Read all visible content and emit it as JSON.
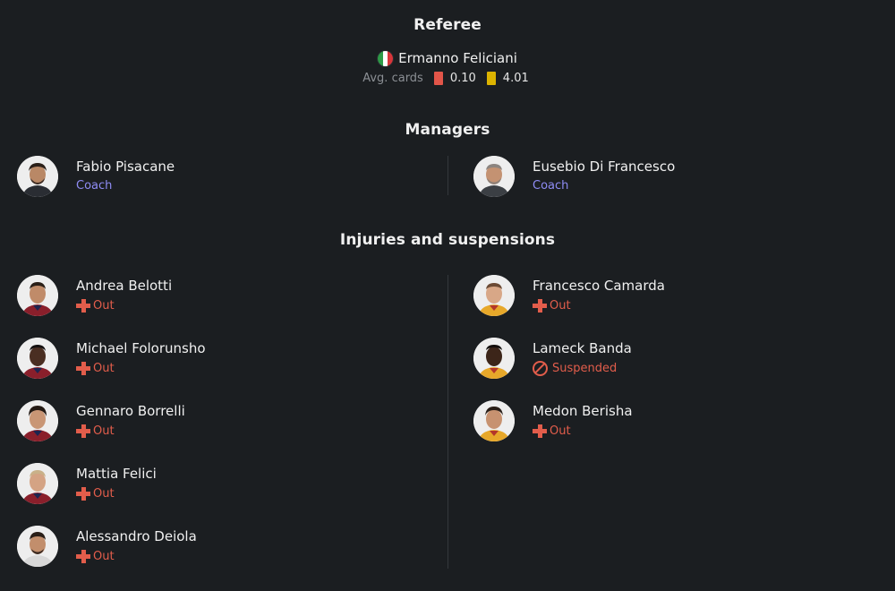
{
  "referee": {
    "title": "Referee",
    "name": "Ermanno Feliciani",
    "flag_icon": "italy-flag-icon",
    "avg_cards_label": "Avg. cards",
    "red_avg": "0.10",
    "yellow_avg": "4.01",
    "colors": {
      "red_card": "#e25549",
      "yellow_card": "#dcb300"
    }
  },
  "managers": {
    "title": "Managers",
    "home": {
      "name": "Fabio Pisacane",
      "role": "Coach"
    },
    "away": {
      "name": "Eusebio Di Francesco",
      "role": "Coach"
    }
  },
  "injuries": {
    "title": "Injuries and suspensions",
    "home": [
      {
        "name": "Andrea Belotti",
        "status": "Out",
        "icon": "injury-cross-icon"
      },
      {
        "name": "Michael Folorunsho",
        "status": "Out",
        "icon": "injury-cross-icon"
      },
      {
        "name": "Gennaro Borrelli",
        "status": "Out",
        "icon": "injury-cross-icon"
      },
      {
        "name": "Mattia Felici",
        "status": "Out",
        "icon": "injury-cross-icon"
      },
      {
        "name": "Alessandro Deiola",
        "status": "Out",
        "icon": "injury-cross-icon"
      }
    ],
    "away": [
      {
        "name": "Francesco Camarda",
        "status": "Out",
        "icon": "injury-cross-icon"
      },
      {
        "name": "Lameck Banda",
        "status": "Suspended",
        "icon": "suspended-icon"
      },
      {
        "name": "Medon Berisha",
        "status": "Out",
        "icon": "injury-cross-icon"
      }
    ]
  },
  "colors": {
    "background": "#1b1e21",
    "status_red": "#e25d4b",
    "coach_purple": "#8f8cf5"
  }
}
